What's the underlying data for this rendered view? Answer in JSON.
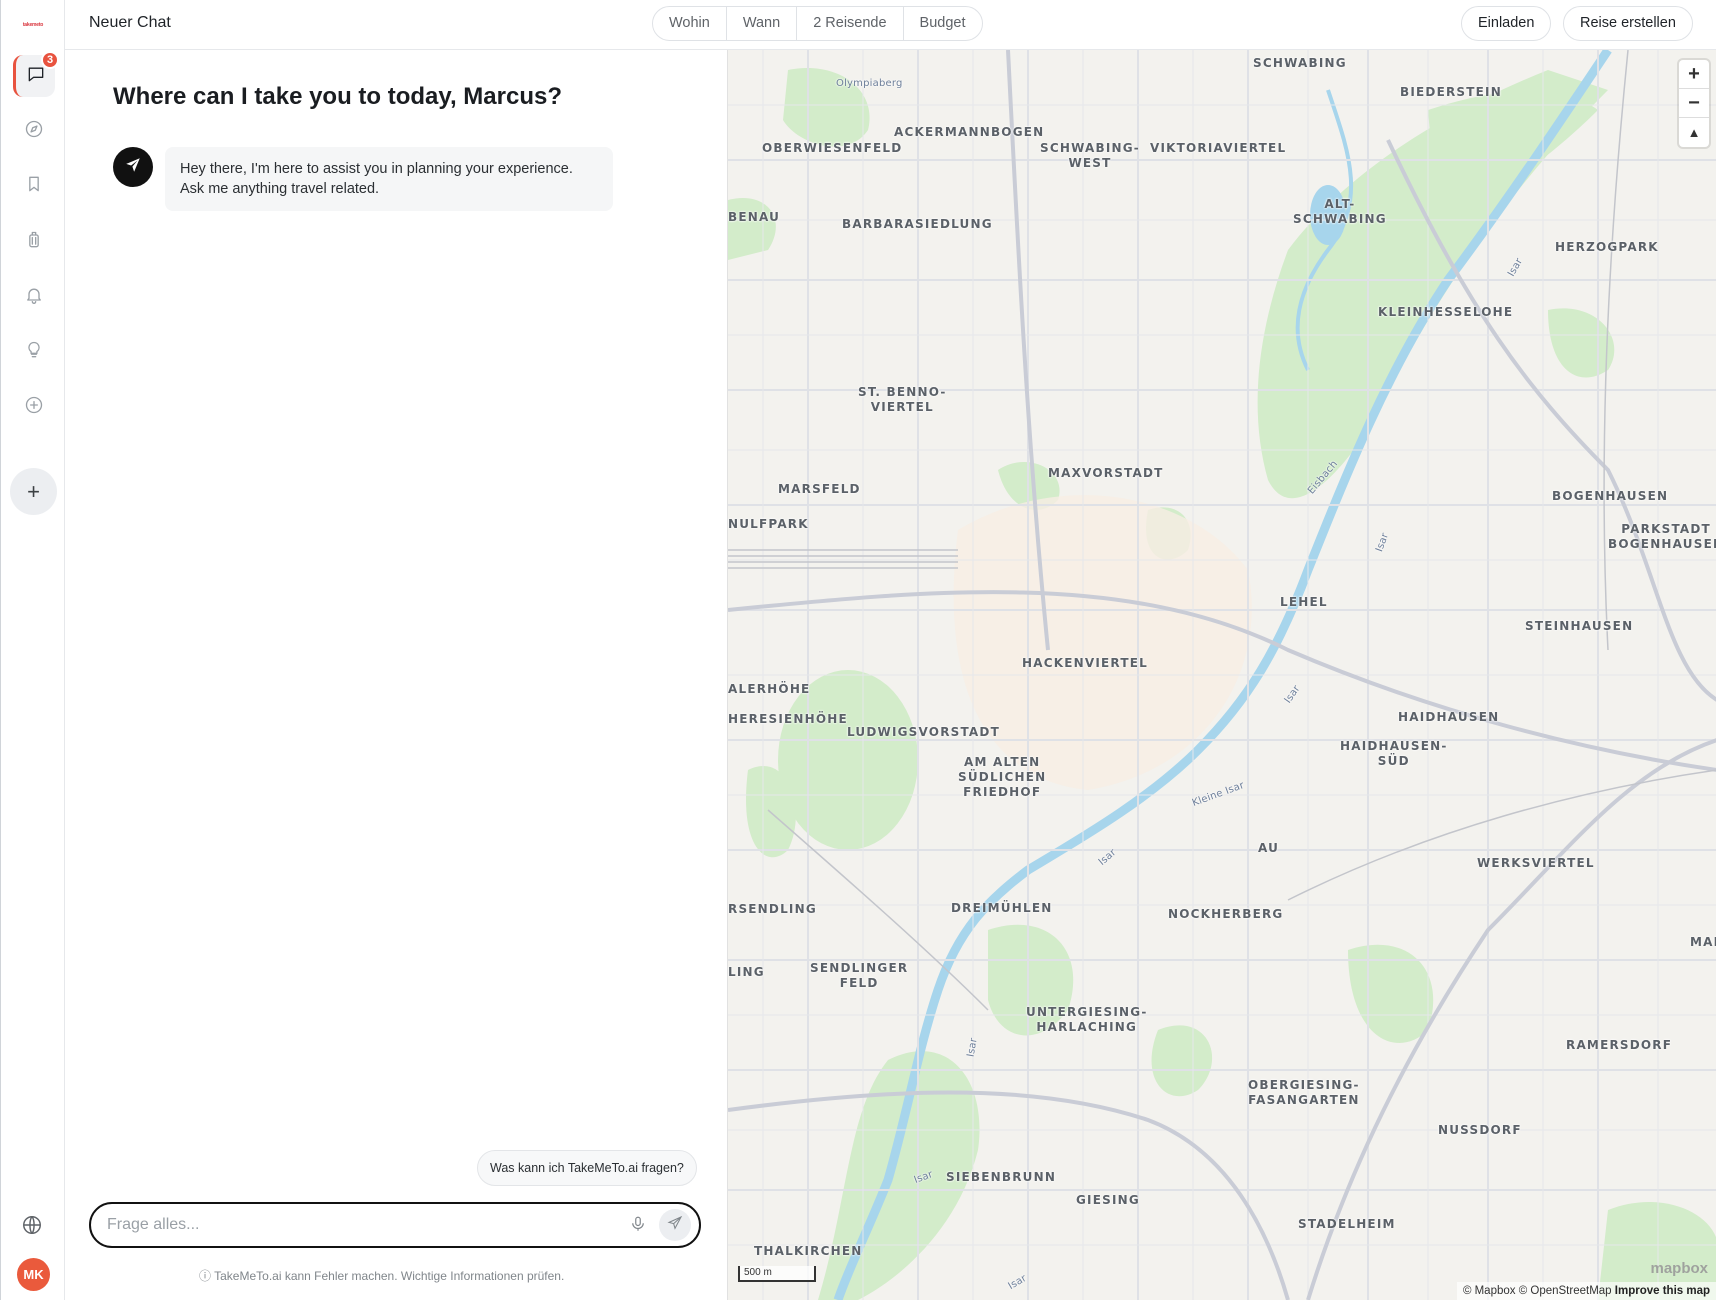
{
  "app": {
    "logo_text": "takemeto"
  },
  "header": {
    "chat_title": "Neuer Chat",
    "filters": [
      "Wohin",
      "Wann",
      "2 Reisende",
      "Budget"
    ],
    "invite_label": "Einladen",
    "create_trip_label": "Reise erstellen"
  },
  "sidebar": {
    "chat_badge": "3",
    "items": [
      {
        "icon": "chat-icon"
      },
      {
        "icon": "compass-icon"
      },
      {
        "icon": "bookmark-icon"
      },
      {
        "icon": "luggage-icon"
      },
      {
        "icon": "bell-icon"
      },
      {
        "icon": "lightbulb-icon"
      },
      {
        "icon": "plus-circle-icon"
      }
    ],
    "add_label": "+",
    "avatar_initials": "MK"
  },
  "chat": {
    "greeting": "Where can I take you to today, Marcus?",
    "bot_message_line1": "Hey there, I'm here to assist you in planning your experience.",
    "bot_message_line2": "Ask me anything travel related.",
    "suggestion": "Was kann ich TakeMeTo.ai fragen?",
    "input_placeholder": "Frage alles...",
    "disclaimer": "TakeMeTo.ai kann Fehler machen. Wichtige Informationen prüfen."
  },
  "map": {
    "labels": [
      "SCHWABING",
      "BIEDERSTEIN",
      "Olympiaberg",
      "ACKERMANNBOGEN",
      "OBERWIESENFELD",
      "SCHWABING-\nWEST",
      "VIKTORIAVIERTEL",
      "ALT-\nSCHWABING",
      "BENAU",
      "BARBARASIEDLUNG",
      "HERZOGPARK",
      "KLEINHESSELOHE",
      "ST. BENNO-\nVIERTEL",
      "MAXVORSTADT",
      "MARSFELD",
      "NULFPARK",
      "BOGENHAUSEN",
      "PARKSTADT\nBOGENHAUSEN",
      "LEHEL",
      "STEINHAUSEN",
      "HACKENVIERTEL",
      "ALERHÖHE",
      "HERESIENHÖHE",
      "LUDWIGSVORSTADT",
      "AM ALTEN\nSÜDLICHEN\nFRIEDHOF",
      "HAIDHAUSEN",
      "HAIDHAUSEN-\nSÜD",
      "AU",
      "WERKSVIERTEL",
      "RSENDLING",
      "DREIMÜHLEN",
      "NOCKHERBERG",
      "LING",
      "SENDLINGER\nFELD",
      "UNTERGIESING-\nHARLACHING",
      "RAMERSDORF",
      "OBERGIESING-\nFASANGARTEN",
      "NUSSDORF",
      "SIEBENBRUNN",
      "GIESING",
      "STADELHEIM",
      "THALKIRCHEN",
      "MAI"
    ],
    "water_labels": [
      "Isar",
      "Eisbach",
      "Isar",
      "Isar",
      "Isar",
      "Kleine Isar",
      "Isar",
      "Isar",
      "Isar"
    ],
    "zoom_in": "+",
    "zoom_out": "−",
    "compass": "▲",
    "scale_label": "500 m",
    "attribution": "© Mapbox © OpenStreetMap",
    "improve_link": "Improve this map",
    "mapbox_logo": "mapbox"
  }
}
